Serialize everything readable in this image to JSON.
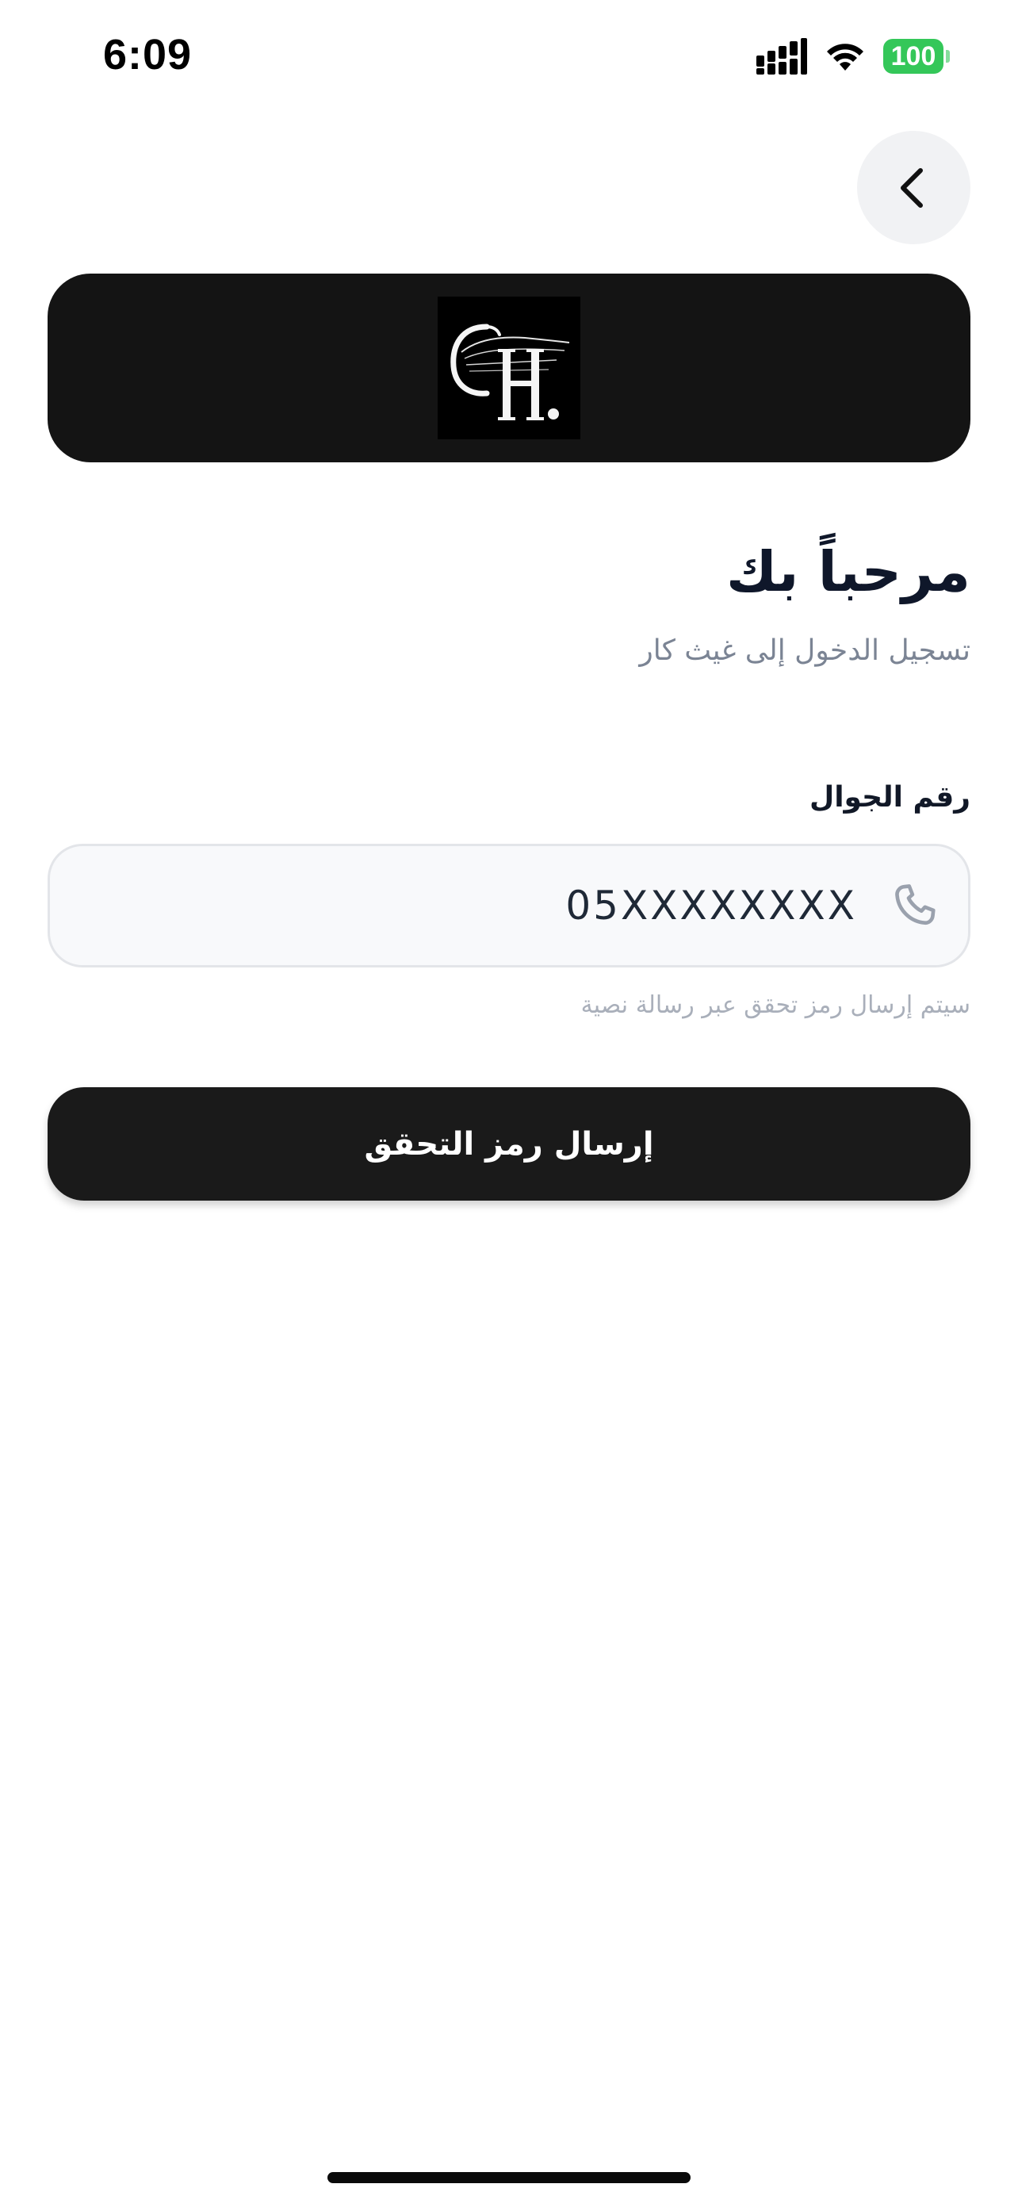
{
  "status_bar": {
    "time": "6:09",
    "battery_level": "100",
    "battery_color": "#34c759",
    "icons": [
      "signal-icon",
      "wifi-icon",
      "battery-icon"
    ]
  },
  "navigation": {
    "back_icon": "chevron-left-icon"
  },
  "logo": {
    "text": "GH.",
    "background": "#000000",
    "banner_color": "#141414"
  },
  "login": {
    "title": "مرحباً بك",
    "subtitle": "تسجيل الدخول إلى غيث كار",
    "phone_label": "رقم الجوال",
    "phone_placeholder": "05XXXXXXXX",
    "phone_icon": "phone-icon",
    "helper_text": "سيتم إرسال رمز تحقق عبر رسالة نصية",
    "submit_label": "إرسال رمز التحقق"
  },
  "colors": {
    "primary_button": "#1a1a1a",
    "title_text": "#0f172a",
    "muted_text": "#7b8494",
    "input_background": "#f8f9fb",
    "input_border": "#e3e5e9"
  }
}
